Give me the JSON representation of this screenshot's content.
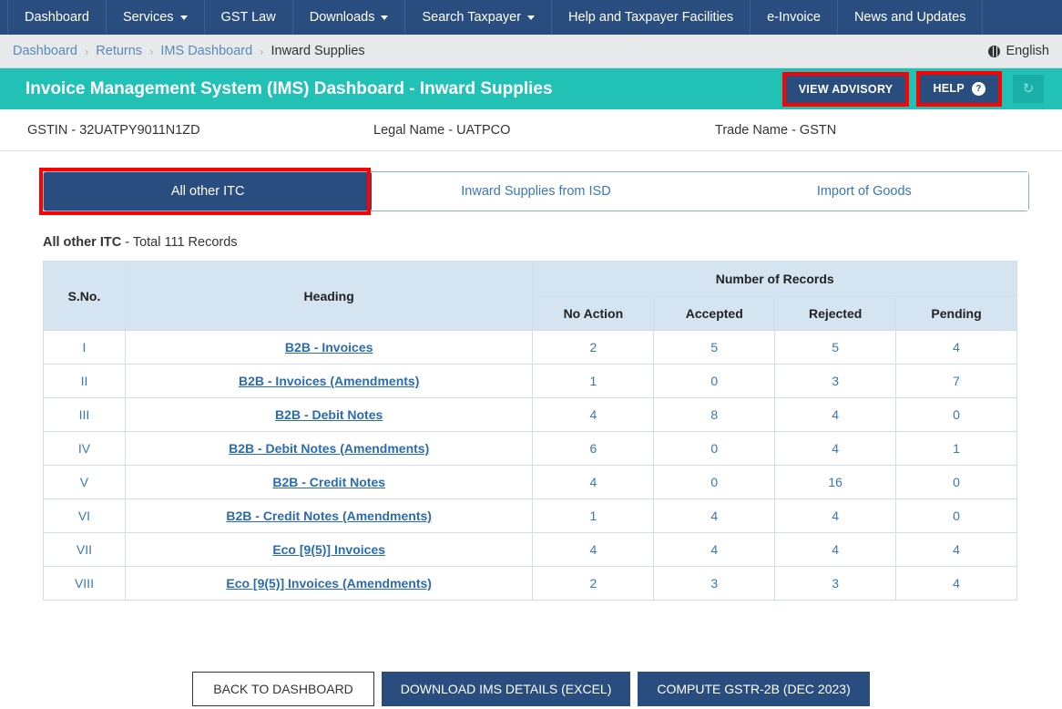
{
  "topnav": {
    "items": [
      {
        "label": "Dashboard",
        "caret": false
      },
      {
        "label": "Services",
        "caret": true
      },
      {
        "label": "GST Law",
        "caret": false
      },
      {
        "label": "Downloads",
        "caret": true
      },
      {
        "label": "Search Taxpayer",
        "caret": true
      },
      {
        "label": "Help and Taxpayer Facilities",
        "caret": false
      },
      {
        "label": "e-Invoice",
        "caret": false
      },
      {
        "label": "News and Updates",
        "caret": false
      }
    ]
  },
  "breadcrumb": {
    "items": [
      "Dashboard",
      "Returns",
      "IMS Dashboard",
      "Inward Supplies"
    ],
    "separator": "›",
    "language": "English"
  },
  "header": {
    "title": "Invoice Management System (IMS) Dashboard - Inward Supplies",
    "view_advisory_label": "VIEW ADVISORY",
    "help_label": "HELP",
    "help_badge": "?",
    "refresh_icon": "↻",
    "accent_teal": "#21c1b6",
    "accent_navy": "#2a4d80",
    "highlight_color": "#ff0000"
  },
  "taxpayer": {
    "gstin": "GSTIN - 32UATPY9011N1ZD",
    "legal_name": "Legal Name - UATPCO",
    "trade_name": "Trade Name - GSTN"
  },
  "tabs": [
    {
      "label": "All other ITC",
      "active": true
    },
    {
      "label": "Inward Supplies from ISD",
      "active": false
    },
    {
      "label": "Import of Goods",
      "active": false
    }
  ],
  "table": {
    "caption_bold": "All other ITC",
    "caption_rest": " - Total 111 Records",
    "group_header": "Number of Records",
    "columns": {
      "sno": "S.No.",
      "heading": "Heading",
      "no_action": "No Action",
      "accepted": "Accepted",
      "rejected": "Rejected",
      "pending": "Pending"
    },
    "column_colors": {
      "no_action": "#222222",
      "accepted": "#0a8a0a",
      "rejected": "#ff0000",
      "pending": "#ffa006"
    },
    "rows": [
      {
        "sno": "I",
        "heading": "B2B - Invoices",
        "no_action": "2",
        "accepted": "5",
        "rejected": "5",
        "pending": "4"
      },
      {
        "sno": "II",
        "heading": "B2B - Invoices (Amendments)",
        "no_action": "1",
        "accepted": "0",
        "rejected": "3",
        "pending": "7"
      },
      {
        "sno": "III",
        "heading": "B2B - Debit Notes",
        "no_action": "4",
        "accepted": "8",
        "rejected": "4",
        "pending": "0"
      },
      {
        "sno": "IV",
        "heading": "B2B - Debit Notes (Amendments)",
        "no_action": "6",
        "accepted": "0",
        "rejected": "4",
        "pending": "1"
      },
      {
        "sno": "V",
        "heading": "B2B - Credit Notes",
        "no_action": "4",
        "accepted": "0",
        "rejected": "16",
        "pending": "0"
      },
      {
        "sno": "VI",
        "heading": "B2B - Credit Notes (Amendments)",
        "no_action": "1",
        "accepted": "4",
        "rejected": "4",
        "pending": "0"
      },
      {
        "sno": "VII",
        "heading": "Eco [9(5)] Invoices",
        "no_action": "4",
        "accepted": "4",
        "rejected": "4",
        "pending": "4"
      },
      {
        "sno": "VIII",
        "heading": "Eco [9(5)] Invoices (Amendments)",
        "no_action": "2",
        "accepted": "3",
        "rejected": "3",
        "pending": "4"
      }
    ]
  },
  "footer_buttons": {
    "back": "BACK TO DASHBOARD",
    "download": "DOWNLOAD IMS DETAILS (EXCEL)",
    "compute": "COMPUTE GSTR-2B (DEC 2023)"
  }
}
